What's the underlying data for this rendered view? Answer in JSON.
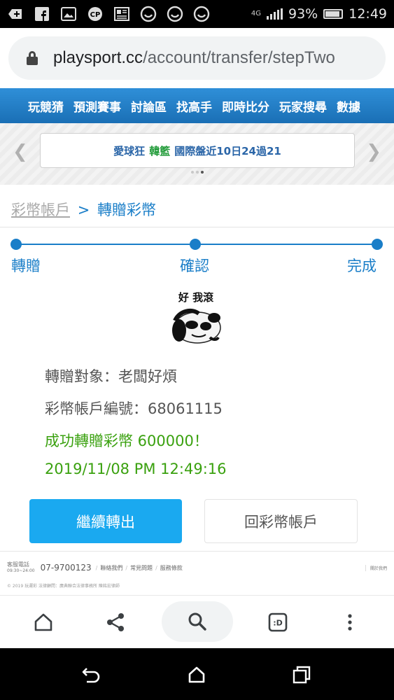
{
  "status_bar": {
    "notification_icons": [
      "add-box-icon",
      "facebook-icon",
      "image-icon",
      "cp-icon",
      "news-icon",
      "smiley-icon",
      "smiley-icon",
      "smiley-icon"
    ],
    "network": "4G",
    "battery": "93%",
    "time": "12:49"
  },
  "browser": {
    "url_host": "playsport.cc",
    "url_path": "/account/transfer/stepTwo"
  },
  "site_nav": {
    "items": [
      "玩競猜",
      "預測賽事",
      "討論區",
      "找高手",
      "即時比分",
      "玩家搜尋",
      "數據"
    ]
  },
  "marquee": {
    "prefix": "愛球狂",
    "tag": "韓籃",
    "text": "國際盤近10日24過21"
  },
  "breadcrumb": {
    "parent": "彩幣帳戶",
    "separator": ">",
    "current": "轉贈彩幣"
  },
  "steps": {
    "items": [
      "轉贈",
      "確認",
      "完成"
    ],
    "completed": 3
  },
  "meme": {
    "caption": "好 我滾"
  },
  "result": {
    "target": "轉贈對象：老闆好煩",
    "account": "彩幣帳戶編號：68061115",
    "success": "成功轉贈彩幣 600000！",
    "datetime": "2019/11/08 PM 12:49:16"
  },
  "actions": {
    "continue_label": "繼續轉出",
    "back_label": "回彩幣帳戶"
  },
  "footer": {
    "cs_label": "客服電話",
    "cs_hours": "09:30~24:00",
    "phone": "07-9700123",
    "links": [
      "聯絡我們",
      "常見問題",
      "服務條款"
    ],
    "right_text": "關於我們",
    "copyright": "© 2019 玩運彩 法律顧問：廣典聯合法律事務所 陳銘宏律師"
  },
  "colors": {
    "accent": "#1a7ec8",
    "primary_button": "#1aa9f0",
    "success": "#3aa10f"
  }
}
